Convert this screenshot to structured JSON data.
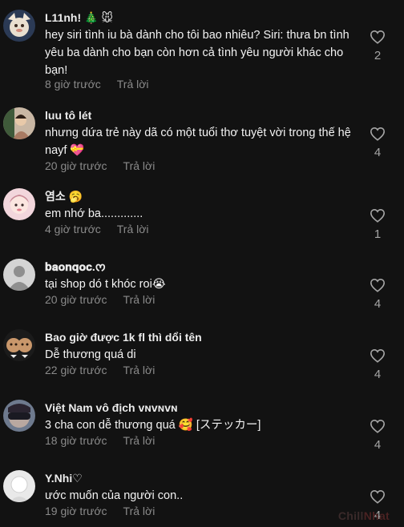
{
  "comments": [
    {
      "username": "L11nh! 🎄 🐭",
      "text": "hey siri tình iu bà dành cho tôi bao nhiêu? Siri: thưa bn tình yêu ba dành cho bạn còn hơn cả tình yêu người khác cho bạn!",
      "time": "8 giờ trước",
      "reply": "Trả lời",
      "likes": "2"
    },
    {
      "username": "luu tô lét",
      "text": "nhưng dứa trẻ này dã có một tuổi thơ tuyệt vời trong thế hệ nayf 💝",
      "time": "20 giờ trước",
      "reply": "Trả lời",
      "likes": "4"
    },
    {
      "username": "염소 🥱",
      "text": "em nhớ ba.............",
      "time": "4 giờ trước",
      "reply": "Trả lời",
      "likes": "1"
    },
    {
      "username": "𝐛𝐚𝐨𝐧𝐪𝐨𝐜.ᰔ",
      "text": "tại shop dó t khóc roi😭",
      "time": "20 giờ trước",
      "reply": "Trả lời",
      "likes": "4"
    },
    {
      "username": "Bao giờ được 1k fl thì dổi tên",
      "text": "Dễ thương quá di",
      "time": "22 giờ trước",
      "reply": "Trả lời",
      "likes": "4"
    },
    {
      "username": "Việt Nam vô địch ᴠɴᴠɴᴠɴ",
      "text": "3 cha con dễ thương quá 🥰 [ステッカー]",
      "time": "18 giờ trước",
      "reply": "Trả lời",
      "likes": "4"
    },
    {
      "username": "Y.Nhi♡",
      "text": "ước muốn của người con..",
      "time": "19 giờ trước",
      "reply": "Trả lời",
      "likes": "4"
    }
  ],
  "watermark": {
    "part1": "Chill",
    "part2": "Nhat"
  },
  "colors": {
    "background": "#121212",
    "meta_text": "#8a8a8a",
    "heart_stroke": "#a5a5a5"
  }
}
